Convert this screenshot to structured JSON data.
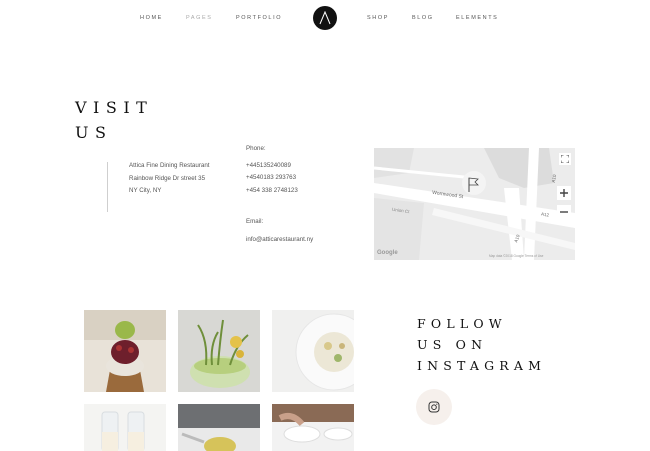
{
  "nav": {
    "left": [
      {
        "label": "HOME"
      },
      {
        "label": "PAGES"
      },
      {
        "label": "PORTFOLIO"
      }
    ],
    "right": [
      {
        "label": "SHOP"
      },
      {
        "label": "BLOG"
      },
      {
        "label": "ELEMENTS"
      }
    ]
  },
  "visit": {
    "title_line1": "VISIT",
    "title_line2": "US"
  },
  "address": {
    "line1": "Attica Fine Dining Restaurant",
    "line2": "Rainbow Ridge Dr street 35",
    "line3": "NY City, NY"
  },
  "contact": {
    "phone_label": "Phone:",
    "phones": [
      "+445135240089",
      "+4540183 293763",
      "+454 338 2748123"
    ],
    "email_label": "Email:",
    "email": "info@atticarestaurant.ny"
  },
  "map": {
    "road1": "Wormwood St",
    "road2": "Union Ct",
    "road3": "A10",
    "road4": "A12",
    "road5": "A10",
    "attribution": "Map data ©2018 Google   Terms of Use",
    "google": "Google"
  },
  "instagram": {
    "line1": "FOLLOW",
    "line2": "US ON",
    "line3": "INSTAGRAM"
  }
}
